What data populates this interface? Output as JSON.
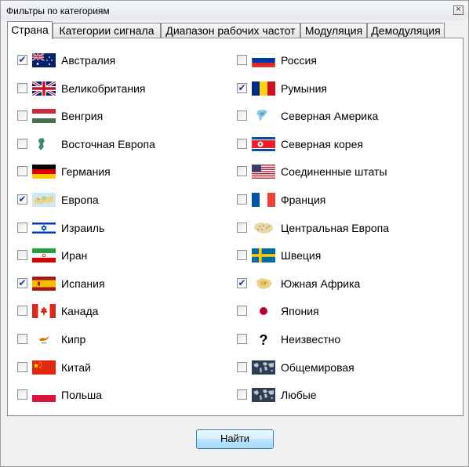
{
  "window": {
    "title": "Фильтры по категориям",
    "close_icon": "close-icon"
  },
  "tabs": [
    {
      "label": "Страна",
      "active": true
    },
    {
      "label": "Категории сигнала",
      "active": false
    },
    {
      "label": "Диапазон рабочих частот",
      "active": false
    },
    {
      "label": "Модуляция",
      "active": false
    },
    {
      "label": "Демодуляция",
      "active": false
    }
  ],
  "countries_left": [
    {
      "label": "Австралия",
      "checked": true,
      "icon": "australia-flag-icon"
    },
    {
      "label": "Великобритания",
      "checked": false,
      "icon": "uk-flag-icon"
    },
    {
      "label": "Венгрия",
      "checked": false,
      "icon": "hungary-flag-icon"
    },
    {
      "label": "Восточная Европа",
      "checked": false,
      "icon": "eastern-europe-map-icon"
    },
    {
      "label": "Германия",
      "checked": false,
      "icon": "germany-flag-icon"
    },
    {
      "label": "Европа",
      "checked": true,
      "icon": "europe-map-icon"
    },
    {
      "label": "Израиль",
      "checked": false,
      "icon": "israel-flag-icon"
    },
    {
      "label": "Иран",
      "checked": false,
      "icon": "iran-flag-icon"
    },
    {
      "label": "Испания",
      "checked": true,
      "icon": "spain-flag-icon"
    },
    {
      "label": "Канада",
      "checked": false,
      "icon": "canada-flag-icon"
    },
    {
      "label": "Кипр",
      "checked": false,
      "icon": "cyprus-map-icon"
    },
    {
      "label": "Китай",
      "checked": false,
      "icon": "china-flag-icon"
    },
    {
      "label": "Польша",
      "checked": false,
      "icon": "poland-flag-icon"
    }
  ],
  "countries_right": [
    {
      "label": "Россия",
      "checked": false,
      "icon": "russia-flag-icon"
    },
    {
      "label": "Румыния",
      "checked": true,
      "icon": "romania-flag-icon"
    },
    {
      "label": "Северная Америка",
      "checked": false,
      "icon": "north-america-map-icon"
    },
    {
      "label": "Северная корея",
      "checked": false,
      "icon": "north-korea-flag-icon"
    },
    {
      "label": "Соединенные штаты",
      "checked": false,
      "icon": "usa-flag-icon"
    },
    {
      "label": "Франция",
      "checked": false,
      "icon": "france-flag-icon"
    },
    {
      "label": "Центральная Европа",
      "checked": false,
      "icon": "central-europe-map-icon"
    },
    {
      "label": "Швеция",
      "checked": false,
      "icon": "sweden-flag-icon"
    },
    {
      "label": "Южная Африка",
      "checked": true,
      "icon": "south-africa-map-icon"
    },
    {
      "label": "Япония",
      "checked": false,
      "icon": "japan-flag-icon"
    },
    {
      "label": "Неизвестно",
      "checked": false,
      "icon": "question-mark-icon"
    },
    {
      "label": "Общемировая",
      "checked": false,
      "icon": "world-map-icon"
    },
    {
      "label": "Любые",
      "checked": false,
      "icon": "world-map-icon"
    }
  ],
  "find_button": "Найти",
  "check_glyph": "✔"
}
